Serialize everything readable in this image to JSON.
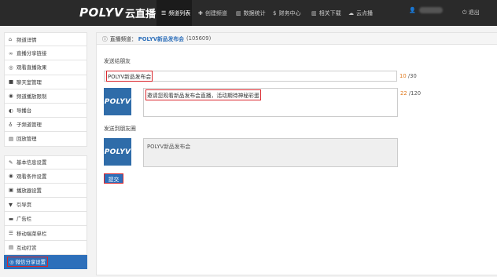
{
  "topbar": {
    "brand": "POLYV",
    "brand_cn": "云直播",
    "nav": [
      {
        "icon": "list-icon",
        "glyph": "☰",
        "label": "频道列表"
      },
      {
        "icon": "plus-icon",
        "glyph": "✚",
        "label": "创建频道"
      },
      {
        "icon": "stats-icon",
        "glyph": "▥",
        "label": "数据统计"
      },
      {
        "icon": "dollar-icon",
        "glyph": "$",
        "label": "财务中心"
      },
      {
        "icon": "download-icon",
        "glyph": "▥",
        "label": "相关下载"
      },
      {
        "icon": "cloud-icon",
        "glyph": "☁",
        "label": "云点播"
      }
    ],
    "logout": "退出"
  },
  "sidebar": {
    "group1": [
      {
        "glyph": "⌂",
        "label": "频道详情"
      },
      {
        "glyph": "∞",
        "label": "直播分享链接"
      },
      {
        "glyph": "◎",
        "label": "观看直播效果"
      },
      {
        "glyph": "■",
        "label": "聊天室管理"
      },
      {
        "glyph": "◉",
        "label": "频道播放限制"
      },
      {
        "glyph": "◐",
        "label": "导播台"
      },
      {
        "glyph": "♁",
        "label": "子频道管理"
      },
      {
        "glyph": "▤",
        "label": "回放管理"
      }
    ],
    "group2": [
      {
        "glyph": "✎",
        "label": "基本信息设置"
      },
      {
        "glyph": "◉",
        "label": "观看条件设置"
      },
      {
        "glyph": "▣",
        "label": "播放器设置"
      },
      {
        "glyph": "▼",
        "label": "引导页"
      },
      {
        "glyph": "▬",
        "label": "广告栏"
      },
      {
        "glyph": "☰",
        "label": "移动端菜单栏"
      },
      {
        "glyph": "▤",
        "label": "互动打赏"
      },
      {
        "glyph": "◎",
        "label": "微信分享设置"
      }
    ]
  },
  "main": {
    "crumb_label": "直播频道：",
    "crumb_title": "POLYV新品发布会",
    "crumb_id": "(105609)",
    "share_friend_label": "发送给朋友",
    "title_value": "POLYV新品发布会",
    "title_count": "10",
    "title_max": "/30",
    "desc_value": "邀请您观看新品发布会直播，活动期待神秘彩蛋",
    "desc_count": "22",
    "desc_max": "/120",
    "thumb_text": "POLYV",
    "share_moments_label": "发送到朋友圈",
    "moments_value": "POLYV新品发布会",
    "submit_label": "提交"
  }
}
